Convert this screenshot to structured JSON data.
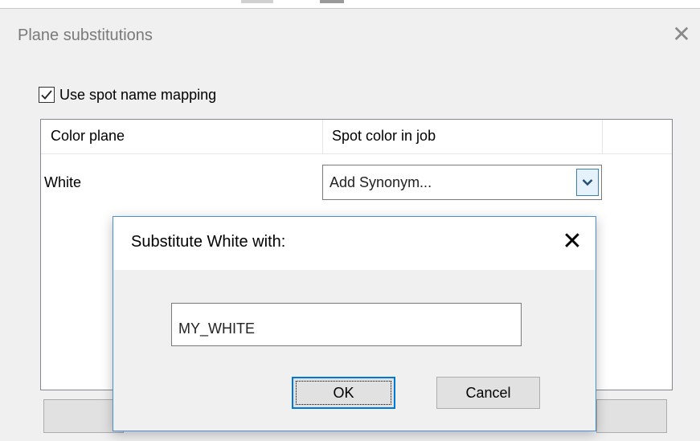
{
  "main_window": {
    "title": "Plane substitutions",
    "close_symbol": "✕",
    "use_mapping": {
      "label": "Use spot name mapping",
      "checked": true
    },
    "grid": {
      "columns": [
        "Color plane",
        "Spot color in job"
      ],
      "rows": [
        {
          "color_plane": "White",
          "spot_color": "Add Synonym..."
        }
      ]
    }
  },
  "dialog": {
    "title": "Substitute White with:",
    "close_symbol": "✕",
    "input_value": "MY_WHITE",
    "ok_label": "OK",
    "cancel_label": "Cancel"
  },
  "colors": {
    "window_bg": "#f0f0f0",
    "dialog_border": "#4a90d9",
    "focus_blue": "#0078d7"
  },
  "icons": {
    "checkbox": "checkmark-icon",
    "dropdown": "chevron-down-icon",
    "close": "close-icon"
  }
}
